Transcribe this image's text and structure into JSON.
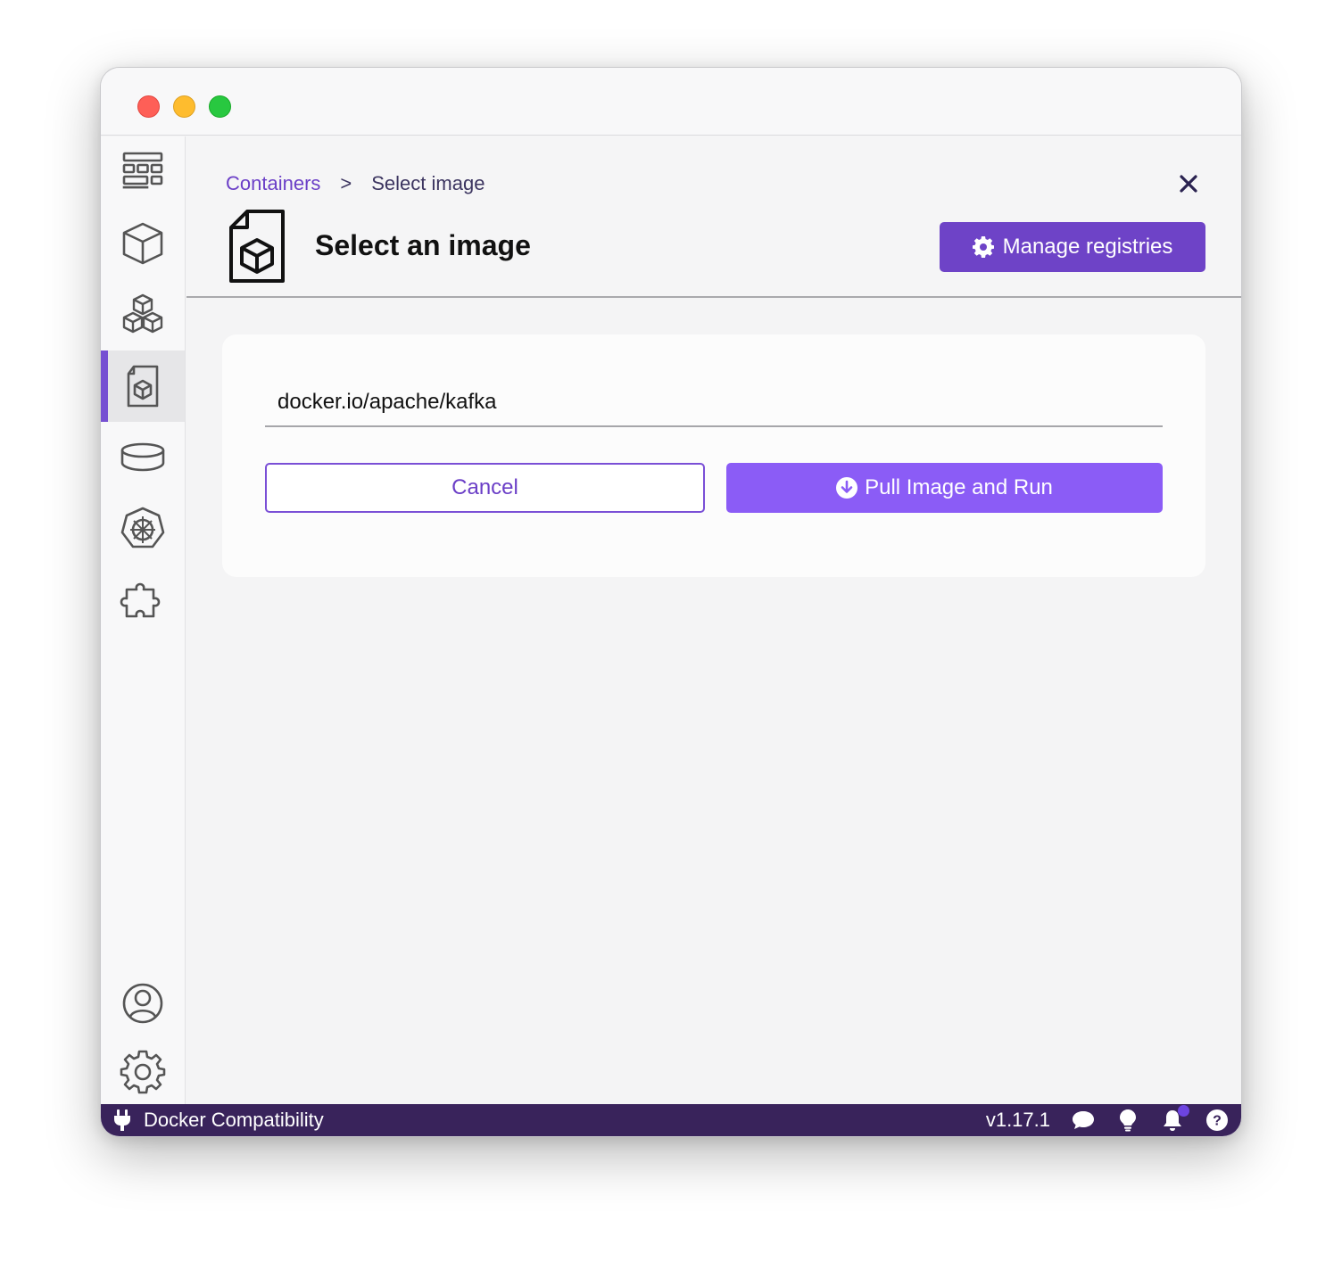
{
  "sidebar": {
    "items": [
      {
        "icon": "dashboard-icon",
        "active": false
      },
      {
        "icon": "containers-icon",
        "active": false
      },
      {
        "icon": "pods-icon",
        "active": false
      },
      {
        "icon": "images-icon",
        "active": true
      },
      {
        "icon": "volumes-icon",
        "active": false
      },
      {
        "icon": "kubernetes-icon",
        "active": false
      },
      {
        "icon": "extensions-icon",
        "active": false
      }
    ],
    "bottom_items": [
      {
        "icon": "account-icon"
      },
      {
        "icon": "settings-icon"
      }
    ]
  },
  "breadcrumb": {
    "parent": "Containers",
    "separator": ">",
    "current": "Select image"
  },
  "header": {
    "title": "Select an image",
    "manage_registries_label": "Manage registries"
  },
  "form": {
    "image_value": "docker.io/apache/kafka",
    "cancel_label": "Cancel",
    "pull_label": "Pull Image and Run"
  },
  "statusbar": {
    "left_label": "Docker Compatibility",
    "version": "v1.17.1"
  },
  "colors": {
    "accent": "#6e43c7",
    "pull_button": "#8b5cf6",
    "statusbar": "#39235b"
  }
}
